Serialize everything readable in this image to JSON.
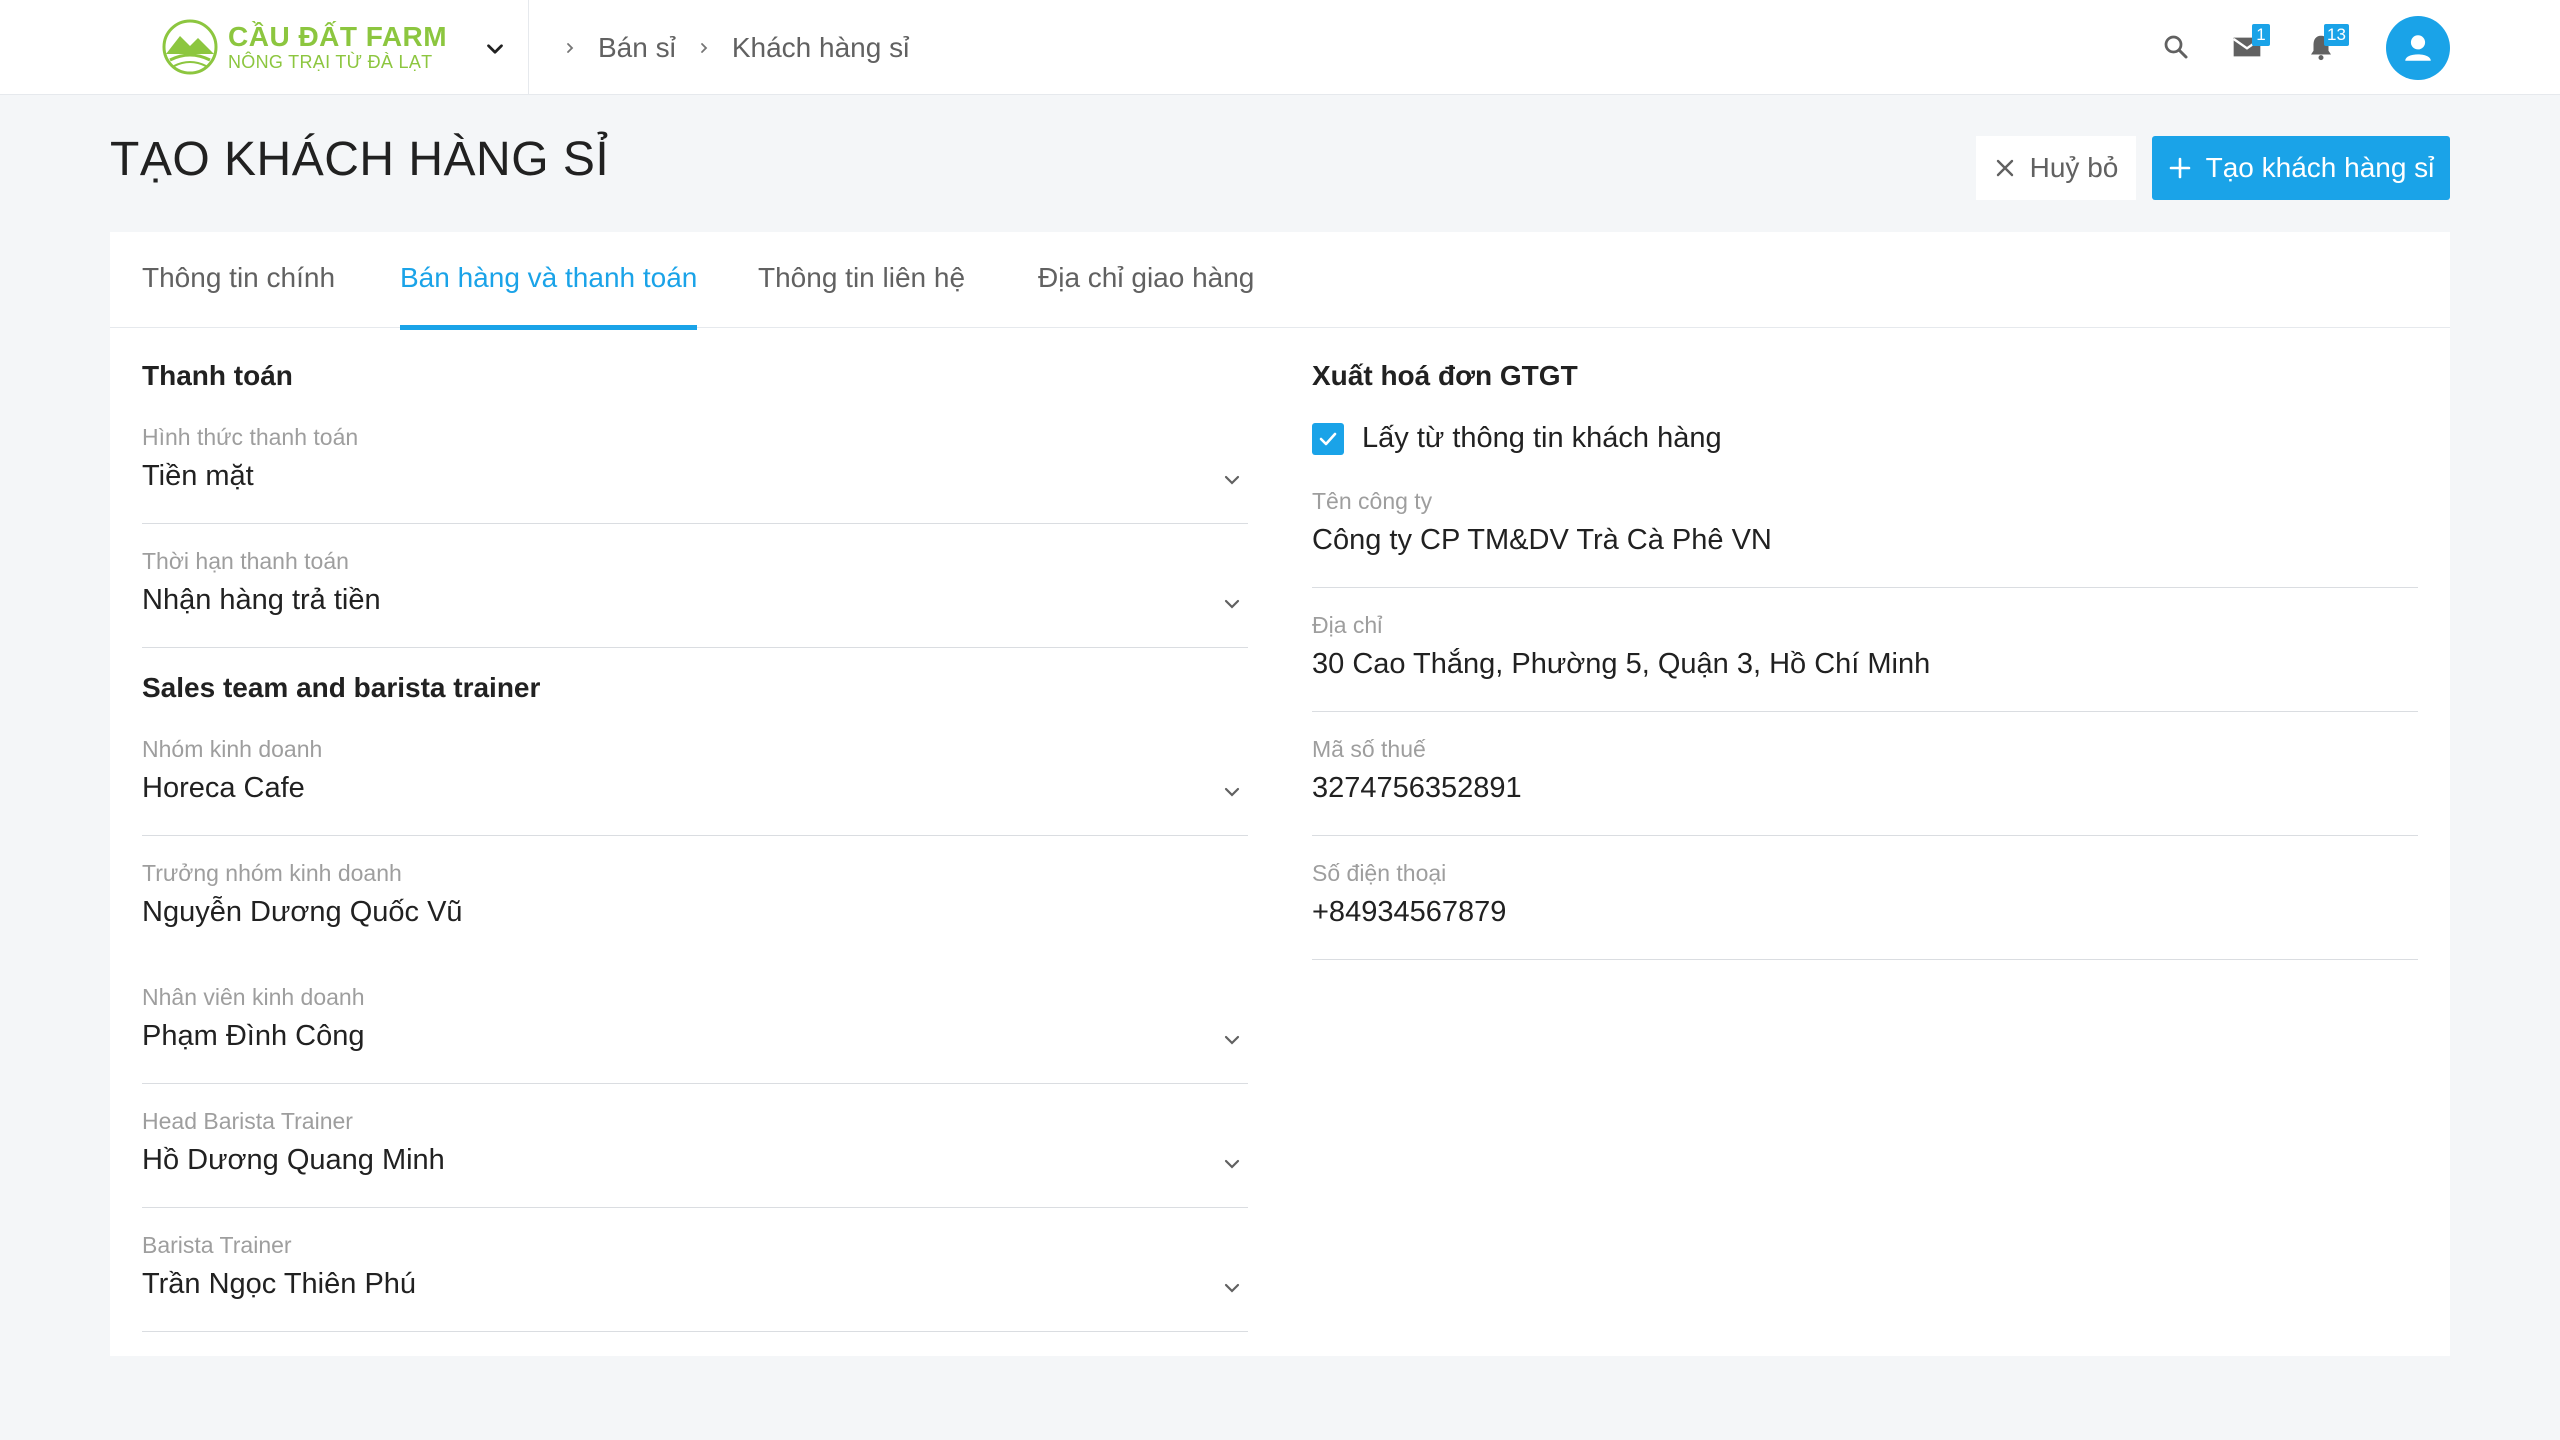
{
  "brand": {
    "name": "CẦU ĐẤT FARM",
    "tagline": "NÔNG TRẠI TỪ ĐÀ LẠT",
    "accent": "#8cc63f"
  },
  "breadcrumb": [
    "Bán sỉ",
    "Khách hàng sỉ"
  ],
  "topbar": {
    "mail_badge": "1",
    "notifications_badge": "13"
  },
  "page": {
    "title": "TẠO KHÁCH HÀNG SỈ",
    "cancel_label": "Huỷ bỏ",
    "create_label": "Tạo khách hàng sỉ"
  },
  "tabs": [
    {
      "label": "Thông tin chính",
      "active": false
    },
    {
      "label": "Bán hàng và thanh toán",
      "active": true
    },
    {
      "label": "Thông tin liên hệ",
      "active": false
    },
    {
      "label": "Địa chỉ giao hàng",
      "active": false
    }
  ],
  "payment": {
    "title": "Thanh toán",
    "method": {
      "label": "Hình thức thanh toán",
      "value": "Tiền mặt"
    },
    "term": {
      "label": "Thời hạn thanh toán",
      "value": "Nhận hàng trả tiền"
    }
  },
  "sales_team": {
    "title": "Sales team and barista trainer",
    "group": {
      "label": "Nhóm kinh doanh",
      "value": "Horeca Cafe"
    },
    "leader": {
      "label": "Trưởng nhóm kinh doanh",
      "value": "Nguyễn Dương Quốc Vũ"
    },
    "staff": {
      "label": "Nhân viên kinh doanh",
      "value": "Phạm Đình Công"
    },
    "head_trainer": {
      "label": "Head Barista Trainer",
      "value": "Hồ Dương Quang Minh"
    },
    "trainer": {
      "label": "Barista Trainer",
      "value": "Trần Ngọc Thiên Phú"
    }
  },
  "invoice": {
    "title": "Xuất hoá đơn GTGT",
    "use_customer_info": {
      "label": "Lấy từ thông tin khách hàng",
      "checked": true
    },
    "company": {
      "label": "Tên công ty",
      "value": "Công ty CP TM&DV Trà Cà Phê VN"
    },
    "address": {
      "label": "Địa chỉ",
      "value": "30 Cao Thắng, Phường 5, Quận 3, Hồ Chí Minh"
    },
    "tax_code": {
      "label": "Mã số thuế",
      "value": "3274756352891"
    },
    "phone": {
      "label": "Số điện thoại",
      "value": "+84934567879"
    }
  },
  "colors": {
    "primary": "#1aa3e8",
    "background": "#f4f6f8",
    "muted_text": "#9e9e9e"
  }
}
